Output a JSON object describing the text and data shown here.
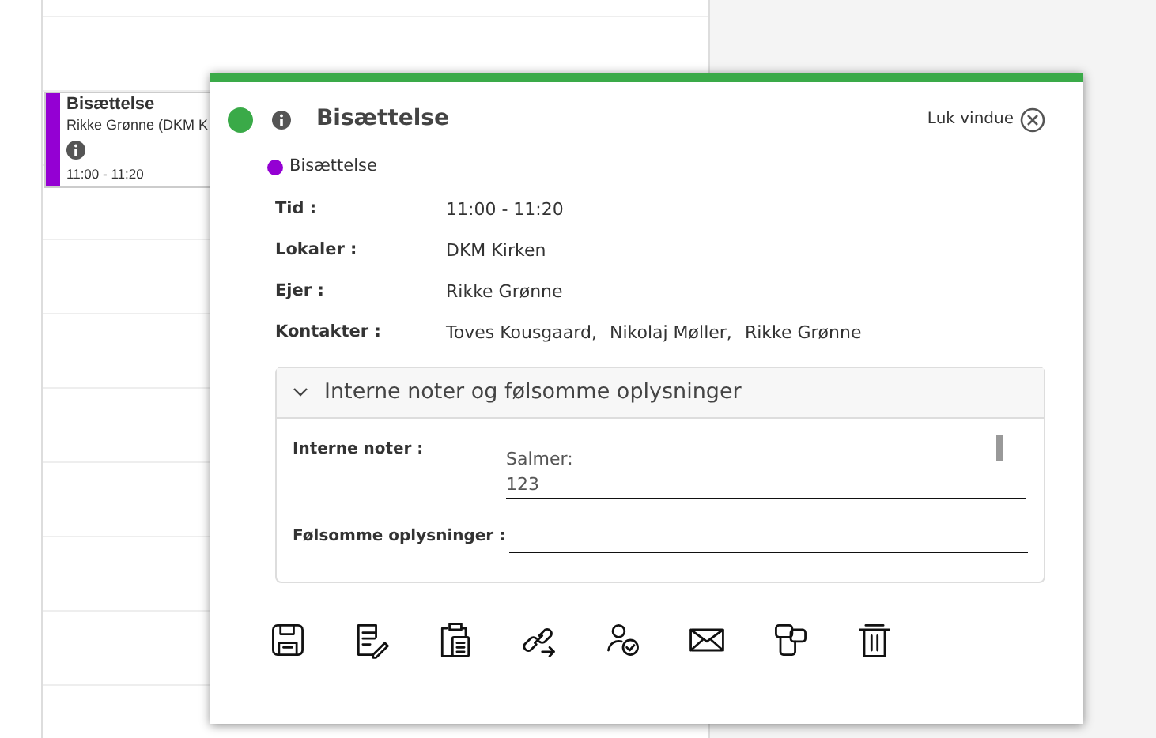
{
  "calendar_event": {
    "title": "Bisættelse",
    "subtitle": "Rikke Grønne (DKM K",
    "time": "11:00 - 11:20",
    "color": "#9400d3"
  },
  "popup": {
    "title": "Bisættelse",
    "close_label": "Luk vindue",
    "category": {
      "label": "Bisættelse",
      "color": "#9400d3"
    },
    "fields": [
      {
        "label": "Tid :",
        "value": "11:00 - 11:20"
      },
      {
        "label": "Lokaler :",
        "value": "DKM Kirken"
      },
      {
        "label": "Ejer :",
        "value": "Rikke Grønne"
      },
      {
        "label": "Kontakter :",
        "values": [
          "Toves Kousgaard,",
          "Nikolaj Møller,",
          "Rikke Grønne"
        ]
      }
    ],
    "notes_section": {
      "title": "Interne noter og følsomme oplysninger",
      "expanded": true,
      "fields": [
        {
          "label": "Interne noter :",
          "lines": [
            "Salmer:",
            "123"
          ]
        },
        {
          "label": "Følsomme oplysninger :"
        }
      ]
    }
  }
}
